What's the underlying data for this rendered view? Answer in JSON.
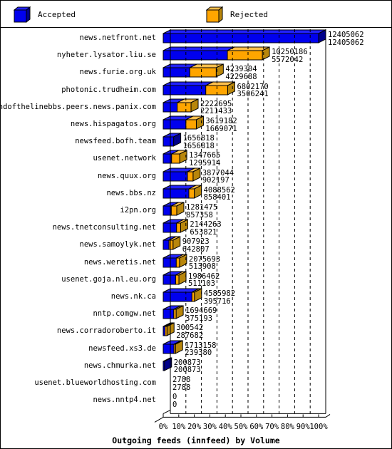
{
  "legend": {
    "items": [
      {
        "label": "Accepted",
        "color": "#0000ee",
        "icon": "cube-swatch-icon"
      },
      {
        "label": "Rejected",
        "color": "#ffa500",
        "icon": "cube-swatch-icon"
      }
    ]
  },
  "chart_data": {
    "type": "bar",
    "orientation": "horizontal",
    "stacked": true,
    "title": "Outgoing feeds (innfeed) by Volume",
    "xlabel": "Outgoing feeds (innfeed) by Volume",
    "ylabel": "",
    "xlim": [
      0,
      100
    ],
    "xtick_labels": [
      "0%",
      "10%",
      "20%",
      "30%",
      "40%",
      "50%",
      "60%",
      "70%",
      "80%",
      "90%",
      "100%"
    ],
    "xtick_values": [
      0,
      10,
      20,
      30,
      40,
      50,
      60,
      70,
      80,
      90,
      100
    ],
    "grid": true,
    "legend_position": "top",
    "categories": [
      "news.netfront.net",
      "nyheter.lysator.liu.se",
      "news.furie.org.uk",
      "photonic.trudheim.com",
      "endofthelinebbs.peers.news.panix.com",
      "news.hispagatos.org",
      "newsfeed.bofh.team",
      "usenet.network",
      "news.quux.org",
      "news.bbs.nz",
      "i2pn.org",
      "news.tnetconsulting.net",
      "news.samoylyk.net",
      "news.weretis.net",
      "usenet.goja.nl.eu.org",
      "news.nk.ca",
      "nntp.comgw.net",
      "news.corradoroberto.it",
      "newsfeed.xs3.de",
      "news.chmurka.net",
      "usenet.blueworldhosting.com",
      "news.nntp4.net"
    ],
    "series": [
      {
        "name": "Accepted",
        "color": "#0000ee",
        "values": [
          12405062,
          10250186,
          4239304,
          6802170,
          2222695,
          3619182,
          1656818,
          1347665,
          3877044,
          4088562,
          1281475,
          2144263,
          907923,
          2075693,
          1986462,
          4585982,
          1694669,
          300542,
          1713158,
          200873,
          2788,
          0
        ]
      },
      {
        "name": "Rejected",
        "color": "#ffa500",
        "values": [
          12405062,
          5572042,
          4229688,
          3506241,
          2211433,
          1669071,
          1656818,
          1295914,
          902197,
          858401,
          857358,
          653821,
          642807,
          513908,
          511103,
          395716,
          375193,
          287682,
          239380,
          200873,
          2788,
          0
        ]
      }
    ],
    "value_labels": [
      {
        "accepted": "12405062",
        "rejected": "12405062"
      },
      {
        "accepted": "10250186",
        "rejected": "5572042"
      },
      {
        "accepted": "4239304",
        "rejected": "4229688"
      },
      {
        "accepted": "6802170",
        "rejected": "3506241"
      },
      {
        "accepted": "2222695",
        "rejected": "2211433"
      },
      {
        "accepted": "3619182",
        "rejected": "1669071"
      },
      {
        "accepted": "1656818",
        "rejected": "1656818"
      },
      {
        "accepted": "1347665",
        "rejected": "1295914"
      },
      {
        "accepted": "3877044",
        "rejected": "902197"
      },
      {
        "accepted": "4088562",
        "rejected": "858401"
      },
      {
        "accepted": "1281475",
        "rejected": "857358"
      },
      {
        "accepted": "2144263",
        "rejected": "653821"
      },
      {
        "accepted": "907923",
        "rejected": "642807"
      },
      {
        "accepted": "2075693",
        "rejected": "513908"
      },
      {
        "accepted": "1986462",
        "rejected": "511103"
      },
      {
        "accepted": "4585982",
        "rejected": "395716"
      },
      {
        "accepted": "1694669",
        "rejected": "375193"
      },
      {
        "accepted": "300542",
        "rejected": "287682"
      },
      {
        "accepted": "1713158",
        "rejected": "239380"
      },
      {
        "accepted": "200873",
        "rejected": "200873"
      },
      {
        "accepted": "2788",
        "rejected": "2788"
      },
      {
        "accepted": "0",
        "rejected": "0"
      }
    ],
    "bar_pct": [
      {
        "accepted": 100.0,
        "rejected": 0.0
      },
      {
        "accepted": 41.3,
        "rejected": 22.5
      },
      {
        "accepted": 17.1,
        "rejected": 17.0
      },
      {
        "accepted": 27.4,
        "rejected": 14.1
      },
      {
        "accepted": 9.0,
        "rejected": 8.9
      },
      {
        "accepted": 14.6,
        "rejected": 6.7
      },
      {
        "accepted": 6.7,
        "rejected": 0.0
      },
      {
        "accepted": 5.4,
        "rejected": 5.2
      },
      {
        "accepted": 15.6,
        "rejected": 3.6
      },
      {
        "accepted": 16.5,
        "rejected": 3.5
      },
      {
        "accepted": 5.2,
        "rejected": 3.5
      },
      {
        "accepted": 8.6,
        "rejected": 2.6
      },
      {
        "accepted": 3.7,
        "rejected": 2.6
      },
      {
        "accepted": 8.4,
        "rejected": 2.1
      },
      {
        "accepted": 8.0,
        "rejected": 2.1
      },
      {
        "accepted": 18.5,
        "rejected": 1.6
      },
      {
        "accepted": 6.8,
        "rejected": 1.5
      },
      {
        "accepted": 1.2,
        "rejected": 1.2
      },
      {
        "accepted": 6.9,
        "rejected": 1.0
      },
      {
        "accepted": 0.8,
        "rejected": 0.0
      },
      {
        "accepted": 0.02,
        "rejected": 0.0
      },
      {
        "accepted": 0.0,
        "rejected": 0.0
      }
    ]
  },
  "colors": {
    "accepted": "#0000ee",
    "accepted_dark": "#00008b",
    "accepted_top": "#2222ff",
    "rejected": "#ffa500",
    "rejected_dark": "#b8860b",
    "rejected_top": "#ffc04d",
    "axis": "#000000",
    "background": "#ffffff"
  }
}
